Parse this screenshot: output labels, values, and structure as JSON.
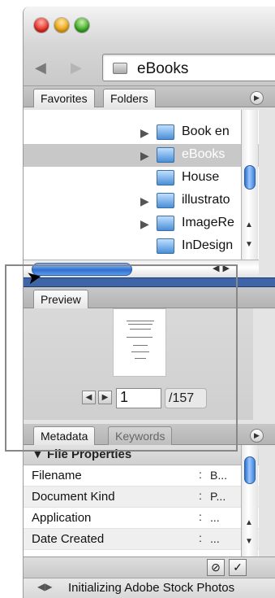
{
  "window": {
    "controls": [
      "close",
      "minimize",
      "zoom"
    ]
  },
  "toolbar": {
    "back_icon": "back-arrow-icon",
    "forward_icon": "forward-arrow-icon",
    "path_folder_icon": "folder-icon",
    "path_label": "eBooks"
  },
  "folders_panel": {
    "tabs": [
      {
        "label": "Favorites",
        "active": false
      },
      {
        "label": "Folders",
        "active": true
      }
    ],
    "items": [
      {
        "label": "Book en",
        "expandable": true,
        "selected": false
      },
      {
        "label": "eBooks",
        "expandable": true,
        "selected": true
      },
      {
        "label": "House",
        "expandable": false,
        "selected": false
      },
      {
        "label": "illustrato",
        "expandable": true,
        "selected": false
      },
      {
        "label": "ImageRe",
        "expandable": true,
        "selected": false
      },
      {
        "label": "InDesign",
        "expandable": false,
        "selected": false
      }
    ]
  },
  "preview_panel": {
    "tab_label": "Preview",
    "page_current": "1",
    "page_total": "/157"
  },
  "metadata_panel": {
    "tabs": [
      {
        "label": "Metadata",
        "active": true
      },
      {
        "label": "Keywords",
        "active": false
      }
    ],
    "section_title": "File Properties",
    "rows": [
      {
        "key": "Filename",
        "value": "B..."
      },
      {
        "key": "Document Kind",
        "value": "P..."
      },
      {
        "key": "Application",
        "value": "..."
      },
      {
        "key": "Date Created",
        "value": "..."
      }
    ]
  },
  "status": {
    "text": "Initializing Adobe Stock Photos"
  },
  "colors": {
    "selection": "#c8c8c8",
    "splitter_blue": "#3f65a8",
    "scroll_thumb_blue": "#2e6fcf"
  }
}
